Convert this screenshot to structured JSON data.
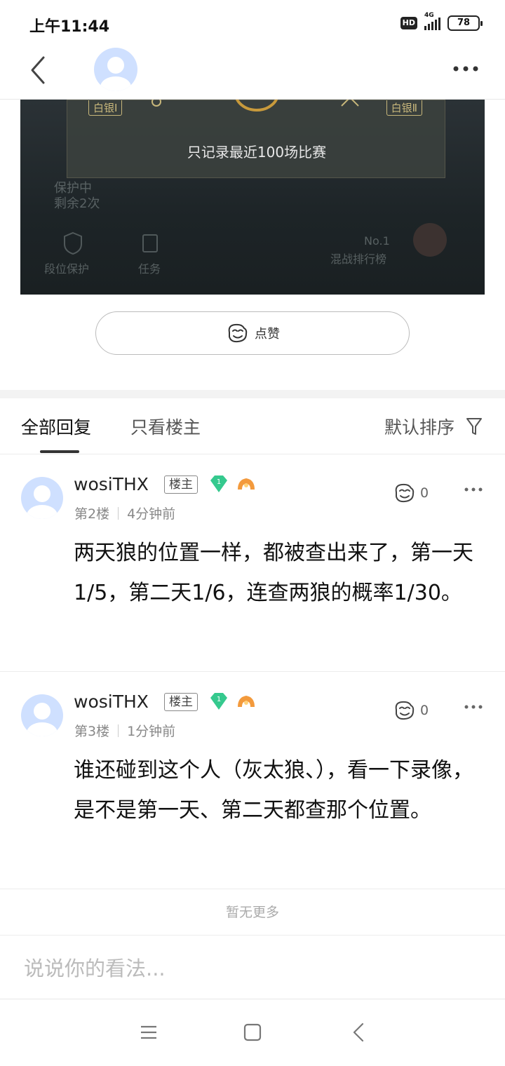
{
  "status_bar": {
    "time": "上午11:44",
    "hd": "HD",
    "network": "4G",
    "battery": "78"
  },
  "post": {
    "image": {
      "rank_left": "白银Ⅰ",
      "rank_right": "白银Ⅱ",
      "record_text": "只记录最近100场比赛",
      "protect_line1": "保护中",
      "protect_line2": "剩余2次",
      "icon_label_1": "段位保护",
      "icon_label_2": "任务",
      "icon_label_3": "No.1",
      "icon_label_4": "混战排行榜"
    },
    "like_label": "点赞"
  },
  "tabs": {
    "all": "全部回复",
    "op_only": "只看楼主",
    "sort": "默认排序"
  },
  "replies": [
    {
      "username": "wosiTHX",
      "badge": "楼主",
      "gem_level": "1",
      "floor": "第2楼",
      "time": "4分钟前",
      "likes": "0",
      "text": "两天狼的位置一样，都被查出来了，第一天1/5，第二天1/6，连查两狼的概率1/30。"
    },
    {
      "username": "wosiTHX",
      "badge": "楼主",
      "gem_level": "1",
      "floor": "第3楼",
      "time": "1分钟前",
      "likes": "0",
      "text": "谁还碰到这个人（灰太狼、），看一下录像，是不是第一天、第二天都查那个位置。"
    }
  ],
  "no_more": "暂无更多",
  "comment": {
    "placeholder": "说说你的看法..."
  },
  "colors": {
    "accent_green": "#35c98e",
    "medal_orange": "#f39a3c",
    "avatar_blue": "#cfe0ff"
  }
}
